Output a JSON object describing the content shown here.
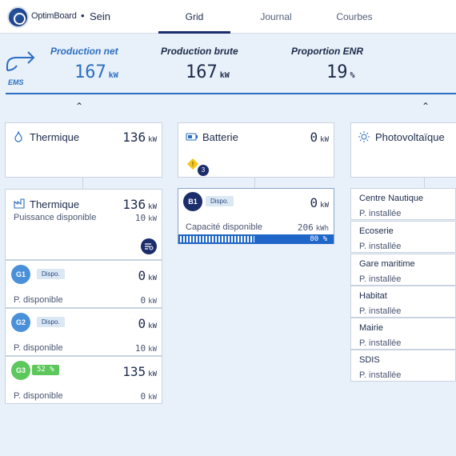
{
  "header": {
    "brand": "OptimBoard",
    "separator": "•",
    "site": "Sein",
    "tabs": [
      "Grid",
      "Journal",
      "Courbes"
    ],
    "active_tab": "Grid"
  },
  "production": {
    "ems_label": "EMS",
    "net": {
      "label": "Production net",
      "value": "167",
      "unit": "kW"
    },
    "brute": {
      "label": "Production brute",
      "value": "167",
      "unit": "kW"
    },
    "enr": {
      "label": "Proportion ENR",
      "value": "19",
      "unit": "%"
    }
  },
  "thermique": {
    "title": "Thermique",
    "value": "136",
    "unit": "kW",
    "detail": {
      "title": "Thermique",
      "value": "136",
      "unit": "kW",
      "sub_label": "Puissance disponible",
      "sub_value": "10",
      "sub_unit": "kW"
    },
    "generators": [
      {
        "id": "G1",
        "status": "Dispo.",
        "value": "0",
        "unit": "kW",
        "sub_label": "P. disponible",
        "sub_value": "0",
        "sub_unit": "kW",
        "color": "#4a90d9"
      },
      {
        "id": "G2",
        "status": "Dispo.",
        "value": "0",
        "unit": "kW",
        "sub_label": "P. disponible",
        "sub_value": "10",
        "sub_unit": "kW",
        "color": "#4a90d9"
      },
      {
        "id": "G3",
        "status": "52 %",
        "value": "135",
        "unit": "kW",
        "sub_label": "P. disponible",
        "sub_value": "0",
        "sub_unit": "kW",
        "color": "#5cc85c"
      }
    ]
  },
  "batterie": {
    "title": "Batterie",
    "value": "0",
    "unit": "kW",
    "alert_count": "3",
    "unit_card": {
      "id": "B1",
      "status": "Dispo.",
      "value": "0",
      "unit": "kW",
      "sub_label": "Capacité disponible",
      "sub_value": "206",
      "sub_unit": "kWh",
      "charge_text": "80 %",
      "charge_fraction": 0.8
    }
  },
  "photovoltaique": {
    "title": "Photovoltaïque",
    "sites": [
      {
        "name": "Centre Nautique",
        "sub": "P. installée"
      },
      {
        "name": "Ecoserie",
        "sub": "P. installée"
      },
      {
        "name": "Gare maritime",
        "sub": "P. installée"
      },
      {
        "name": "Habitat",
        "sub": "P. installée"
      },
      {
        "name": "Mairie",
        "sub": "P. installée"
      },
      {
        "name": "SDIS",
        "sub": "P. installée"
      }
    ]
  },
  "colors": {
    "accent": "#2b6fc2",
    "navy": "#1b2d6b",
    "green": "#5cc85c",
    "warning": "#f5c518"
  }
}
